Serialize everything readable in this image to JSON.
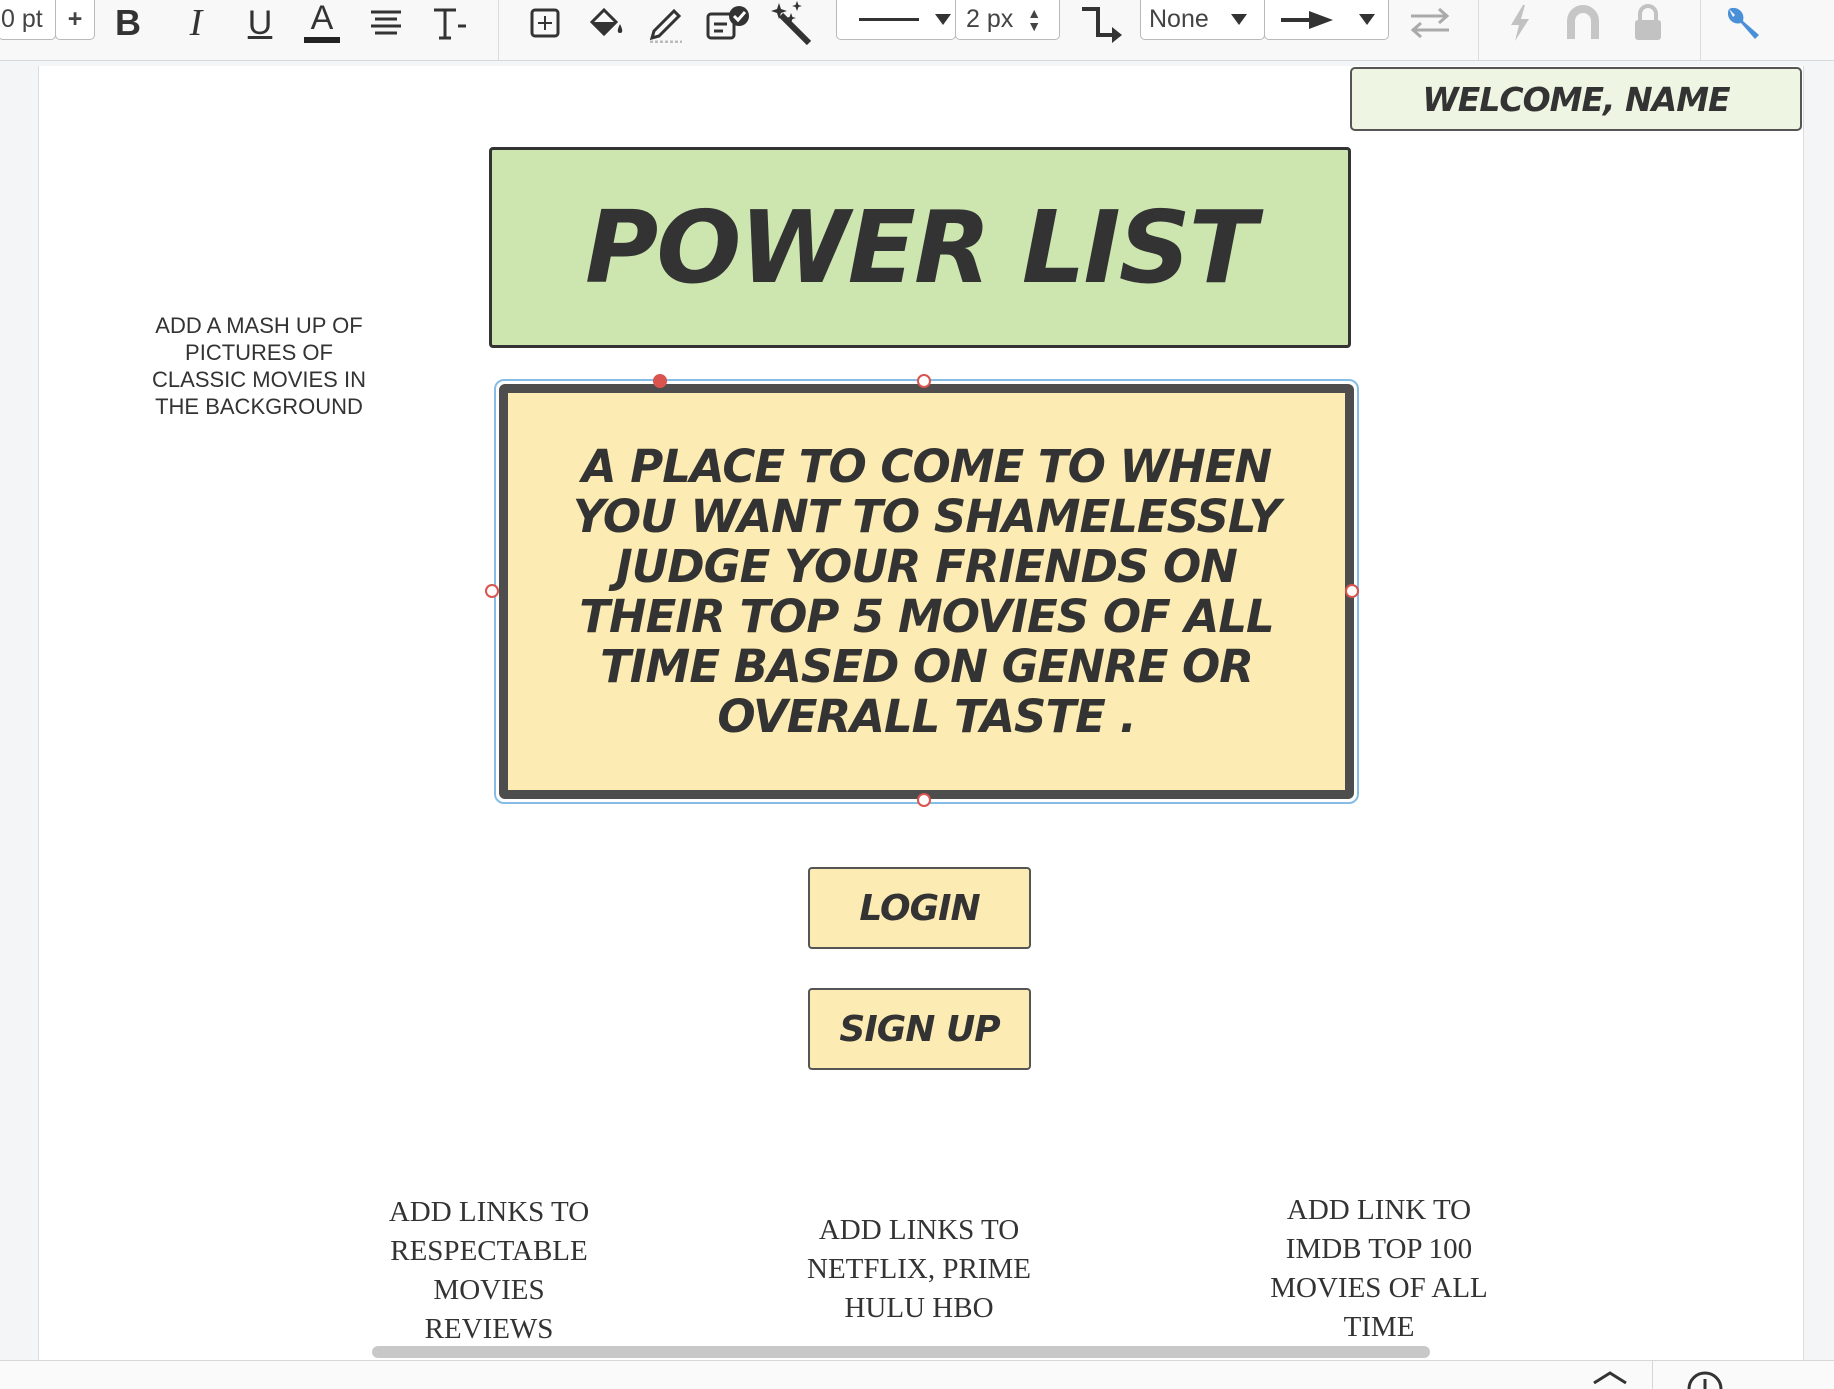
{
  "toolbar": {
    "font_size": "0 pt",
    "font_increase": "+",
    "line_width": "2 px",
    "line_jump": "None"
  },
  "canvas": {
    "welcome": "WELCOME, NAME",
    "title": "POWER LIST",
    "description": "A PLACE TO COME TO WHEN YOU WANT TO SHAMELESSLY JUDGE YOUR FRIENDS ON THEIR TOP 5 MOVIES OF ALL TIME BASED ON GENRE OR OVERALL TASTE .",
    "login": "LOGIN",
    "signup": "SIGN UP",
    "note_background": "ADD A MASH UP OF PICTURES OF CLASSIC MOVIES IN THE BACKGROUND",
    "note_reviews": "ADD LINKS TO RESPECTABLE MOVIES REVIEWS",
    "note_streaming": "ADD LINKS TO NETFLIX, PRIME HULU HBO",
    "note_imdb": "ADD LINK TO IMDB TOP 100 MOVIES OF ALL TIME"
  },
  "colors": {
    "title_fill": "#cde6b0",
    "welcome_fill": "#eef5e3",
    "description_fill": "#fcebb3",
    "button_fill": "#fcebb3",
    "selection_handle": "#d9534f",
    "selection_outline": "#85bde6"
  },
  "icons": [
    "bold-icon",
    "italic-icon",
    "underline-icon",
    "font-color-icon",
    "align-icon",
    "text-format-icon",
    "select-frame-icon",
    "fill-icon",
    "line-color-icon",
    "style-check-icon",
    "magic-wand-icon",
    "line-style-icon",
    "connector-icon",
    "arrow-end-icon",
    "swap-icon",
    "lightning-icon",
    "magnet-icon",
    "lock-icon",
    "wrench-icon"
  ]
}
